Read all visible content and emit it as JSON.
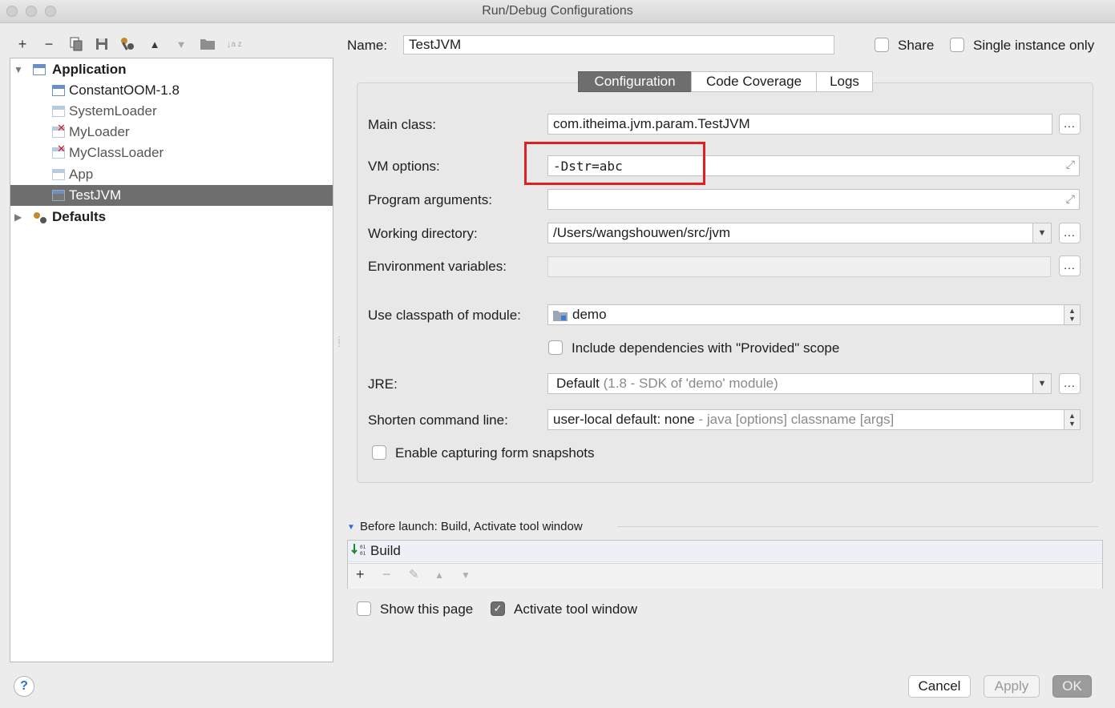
{
  "window": {
    "title": "Run/Debug Configurations"
  },
  "toolbar": {
    "add": "+",
    "remove": "−",
    "copy": "copy",
    "save": "save",
    "wrench": "wrench",
    "up": "▲",
    "down": "▼",
    "folder": "folder",
    "sort": "sort"
  },
  "tree": {
    "application": {
      "label": "Application",
      "expanded": true
    },
    "items": [
      {
        "label": "ConstantOOM-1.8",
        "icon": "application-config-icon"
      },
      {
        "label": "SystemLoader",
        "icon": "application-config-faded-icon"
      },
      {
        "label": "MyLoader",
        "icon": "application-config-error-icon"
      },
      {
        "label": "MyClassLoader",
        "icon": "application-config-error-icon"
      },
      {
        "label": "App",
        "icon": "application-config-faded-icon"
      },
      {
        "label": "TestJVM",
        "icon": "application-config-icon",
        "selected": true
      }
    ],
    "defaults": {
      "label": "Defaults",
      "expanded": false
    }
  },
  "header": {
    "name_label": "Name:",
    "name_value": "TestJVM",
    "share_label": "Share",
    "single_instance_label": "Single instance only"
  },
  "tabs": [
    {
      "label": "Configuration",
      "active": true
    },
    {
      "label": "Code Coverage",
      "active": false
    },
    {
      "label": "Logs",
      "active": false
    }
  ],
  "form": {
    "main_class_label": "Main class:",
    "main_class_value": "com.itheima.jvm.param.TestJVM",
    "vm_options_label": "VM options:",
    "vm_options_value": "-Dstr=abc",
    "program_args_label": "Program arguments:",
    "program_args_value": "",
    "working_dir_label": "Working directory:",
    "working_dir_value": "/Users/wangshouwen/src/jvm",
    "env_vars_label": "Environment variables:",
    "env_vars_value": "",
    "classpath_label": "Use classpath of module:",
    "classpath_value": "demo",
    "include_provided_label": "Include dependencies with \"Provided\" scope",
    "jre_label": "JRE:",
    "jre_value": "Default",
    "jre_hint": "(1.8 - SDK of 'demo' module)",
    "shorten_label": "Shorten command line:",
    "shorten_value": "user-local default: none",
    "shorten_hint": "- java [options] classname [args]",
    "snapshots_label": "Enable capturing form snapshots",
    "more": "..."
  },
  "before_launch": {
    "title": "Before launch: Build, Activate tool window",
    "items": [
      {
        "label": "Build"
      }
    ],
    "add": "+",
    "remove": "−",
    "edit": "✎",
    "up": "▲",
    "down": "▼"
  },
  "footer": {
    "show_page_label": "Show this page",
    "show_page_checked": false,
    "activate_label": "Activate tool window",
    "activate_checked": true,
    "help": "?",
    "cancel": "Cancel",
    "apply": "Apply",
    "ok": "OK"
  },
  "colors": {
    "highlight": "#e02020",
    "selection": "#6e6e6e"
  }
}
